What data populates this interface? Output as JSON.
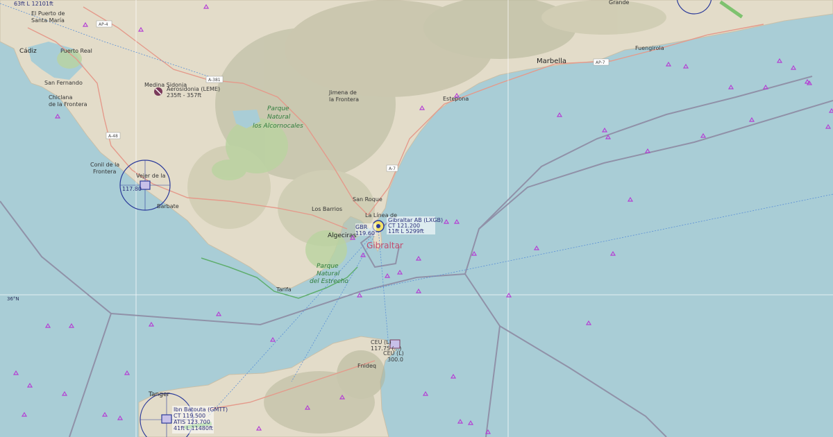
{
  "map": {
    "places": {
      "el_puerto": [
        "El Puerto de",
        "Santa María"
      ],
      "cadiz": "Cádiz",
      "puerto_real": "Puerto Real",
      "san_fernando": "San Fernando",
      "chiclana": [
        "Chiclana",
        "de la Frontera"
      ],
      "medina": "Medina Sidonia",
      "conil": [
        "Conil de la",
        "Frontera"
      ],
      "vejer": [
        "Vejer de la",
        "Frontera"
      ],
      "barbate": "Barbate",
      "jimena": [
        "Jimena de",
        "la Frontera"
      ],
      "estepona": "Estepona",
      "marbella": "Marbella",
      "fuengirola": "Fuengirola",
      "grande": "Grande",
      "los_barrios": "Los Barrios",
      "san_roque": "San Roque",
      "la_linea": [
        "La Línea de",
        "la Concepción"
      ],
      "algeciras": "Algeciras",
      "gibraltar": "Gibraltar",
      "tarifa": "Tarifa",
      "tanger": "Tanger",
      "fnideq": "Fnideq"
    },
    "parks": {
      "alcornocales": [
        "Parque",
        "Natural",
        "los Alcornocales"
      ],
      "estrecho": [
        "Parque",
        "Natural",
        "del Estrecho"
      ]
    },
    "roads": [
      "AP-4",
      "A-381",
      "A-48",
      "AP-7",
      "A-7"
    ],
    "latitude_label": "36°N",
    "airports": {
      "top_left_info": "63ft L 12101ft",
      "rota_info": "117.80",
      "leme": {
        "name": "Aerosidonia (LEME)",
        "info": "235ft - 357ft"
      },
      "lxgb": {
        "name": "Gibraltar AB (LXGB)",
        "freq": "CT 121.200",
        "info": "11ft L 5299ft"
      },
      "lxgb_navaid": [
        "GBR",
        "119.60"
      ],
      "gmtt": {
        "name": "Ibn Batouta (GMTT)",
        "ct": "CT 119.500",
        "atis": "ATIS 123.700",
        "info": "41ft L 11480ft"
      },
      "ceu": [
        "CEU (L)",
        "117.75 (...)",
        "CEU (L)",
        "300.0"
      ]
    }
  }
}
